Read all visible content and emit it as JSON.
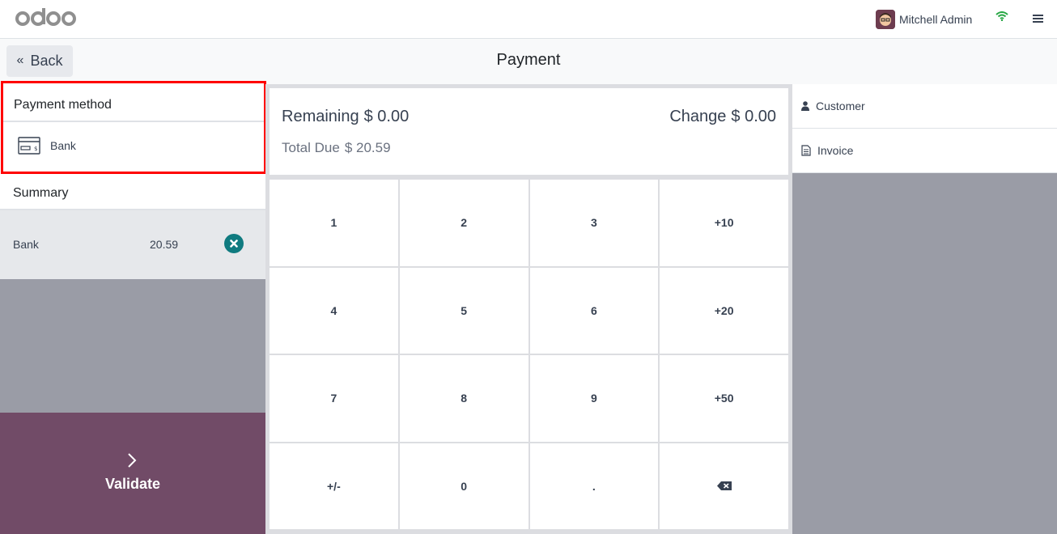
{
  "app": {
    "logo_text": "odoo",
    "user_name": "Mitchell Admin"
  },
  "control": {
    "back_label": "Back",
    "title": "Payment"
  },
  "payment_methods": {
    "title": "Payment method",
    "items": [
      {
        "label": "Bank",
        "icon": "credit-card-icon"
      }
    ]
  },
  "summary": {
    "title": "Summary",
    "lines": [
      {
        "name": "Bank",
        "amount": "20.59"
      }
    ]
  },
  "validate_label": "Validate",
  "totals": {
    "remaining_label": "Remaining",
    "remaining_value": "$ 0.00",
    "change_label": "Change",
    "change_value": "$ 0.00",
    "total_due_label": "Total Due",
    "total_due_value": "$ 20.59"
  },
  "numpad": {
    "keys": [
      "1",
      "2",
      "3",
      "+10",
      "4",
      "5",
      "6",
      "+20",
      "7",
      "8",
      "9",
      "+50",
      "+/-",
      "0",
      ".",
      "⌫"
    ]
  },
  "right_panel": {
    "customer_label": "Customer",
    "invoice_label": "Invoice"
  },
  "colors": {
    "brand": "#714b67",
    "accent": "#107b80",
    "highlight": "#ff0000",
    "wifi": "#28a745"
  }
}
